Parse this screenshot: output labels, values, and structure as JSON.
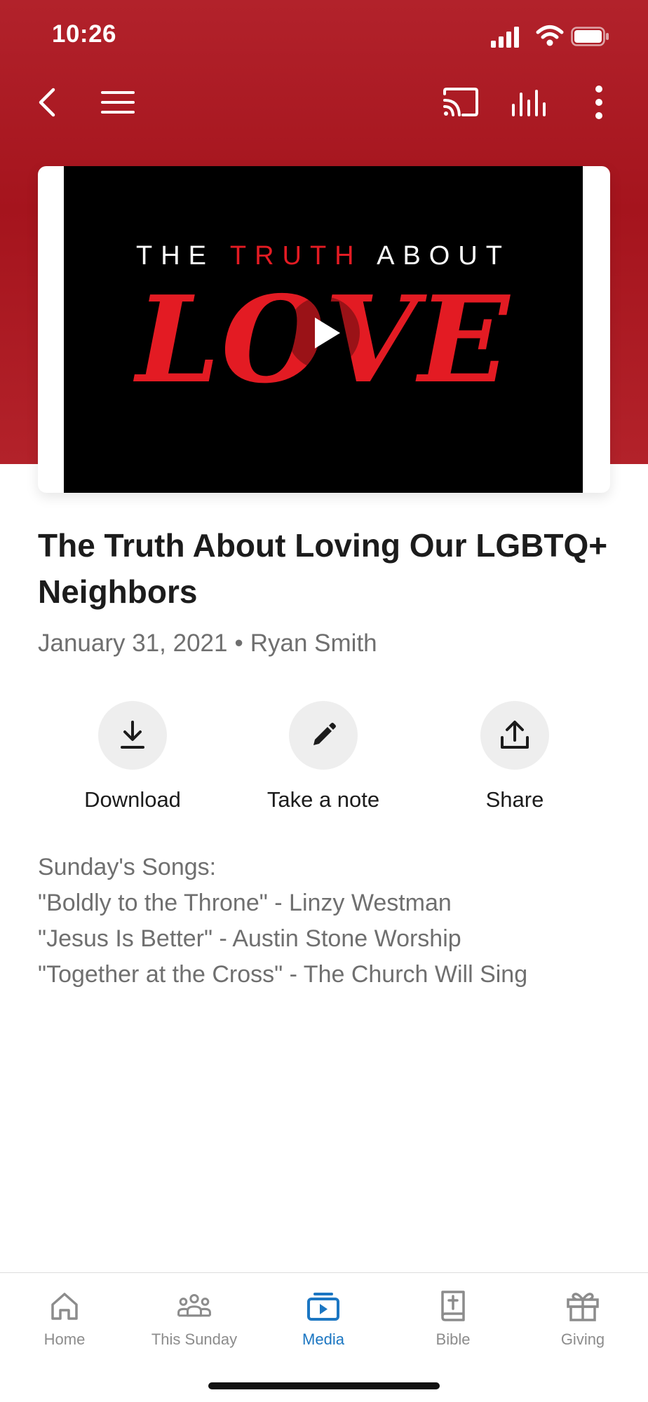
{
  "status_bar": {
    "time": "10:26"
  },
  "toolbar": {
    "back_icon": "chevron-left-icon",
    "menu_icon": "hamburger-menu-icon",
    "cast_icon": "cast-icon",
    "audio_icon": "audio-bars-icon",
    "more_icon": "more-vertical-icon"
  },
  "video": {
    "kicker_before": "THE ",
    "kicker_accent": "TRUTH",
    "kicker_after": " ABOUT",
    "headline": "LOVE",
    "play_icon": "play-icon"
  },
  "sermon": {
    "title": "The Truth About Loving Our LGBTQ+ Neighbors",
    "date": "January 31, 2021",
    "separator": "•",
    "speaker": "Ryan Smith"
  },
  "actions": [
    {
      "label": "Download",
      "icon": "download-icon"
    },
    {
      "label": "Take a note",
      "icon": "pencil-icon"
    },
    {
      "label": "Share",
      "icon": "share-icon"
    }
  ],
  "description": {
    "lines": [
      "Sunday's Songs:",
      "\"Boldly to the Throne\" - Linzy Westman",
      "\"Jesus Is Better\" - Austin Stone Worship",
      "\"Together at the Cross\" - The Church Will Sing"
    ]
  },
  "bottom_nav": {
    "items": [
      {
        "label": "Home",
        "icon": "home-icon",
        "active": false
      },
      {
        "label": "This Sunday",
        "icon": "people-icon",
        "active": false
      },
      {
        "label": "Media",
        "icon": "media-icon",
        "active": true
      },
      {
        "label": "Bible",
        "icon": "bible-icon",
        "active": false
      },
      {
        "label": "Giving",
        "icon": "gift-icon",
        "active": false
      }
    ]
  },
  "colors": {
    "brand_red": "#a5141d",
    "accent_red": "#e31b23",
    "active_nav": "#1b76c2",
    "inactive_nav": "#8c8c8c"
  }
}
